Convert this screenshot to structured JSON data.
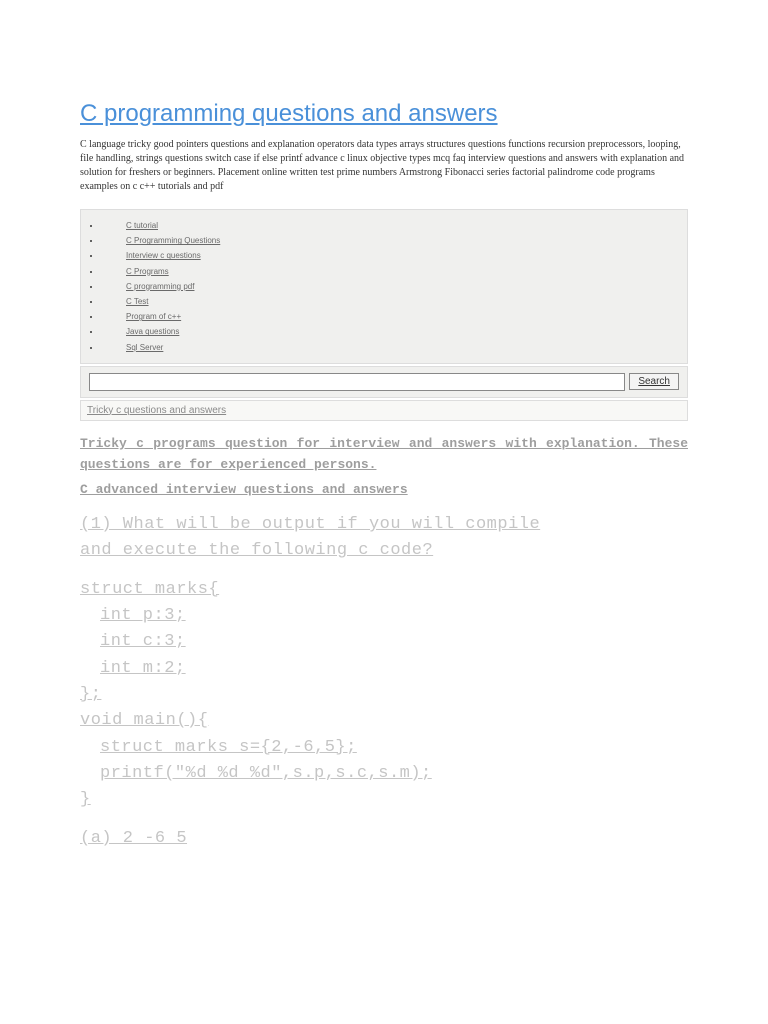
{
  "title": "C programming questions and answers",
  "description": "C language tricky good pointers questions and explanation operators data types arrays structures questions functions recursion preprocessors, looping, file handling, strings questions switch case if else printf advance c linux objective types mcq faq interview questions and answers with explanation and solution for freshers or beginners. Placement online written test prime numbers Armstrong Fibonacci series factorial palindrome code programs examples on c c++ tutorials and pdf",
  "nav": [
    "C tutorial",
    "C Programming Questions",
    "Interview c questions",
    "C Programs",
    "C programming pdf",
    "C Test",
    "Program of c++",
    "Java questions",
    "Sql Server"
  ],
  "search": {
    "button": "Search"
  },
  "articleLink": "Tricky c questions and answers",
  "intro1": "Tricky c programs question for interview and answers with explanation. These questions are for experienced persons.",
  "intro2": "C advanced interview questions and answers",
  "question": {
    "line1": "(1) What will be output if you will compile",
    "line2": "and execute the following c code?",
    "c1": "struct marks{",
    "c2": "int p:3;",
    "c3": "int c:3;",
    "c4": "int m:2;",
    "c5": "};",
    "c6": "void main(){",
    "c7": "struct marks s={2,-6,5};",
    "c8": "printf(\"%d %d %d\",s.p,s.c,s.m);",
    "c9": "}",
    "optA": "(a) 2 -6 5"
  }
}
